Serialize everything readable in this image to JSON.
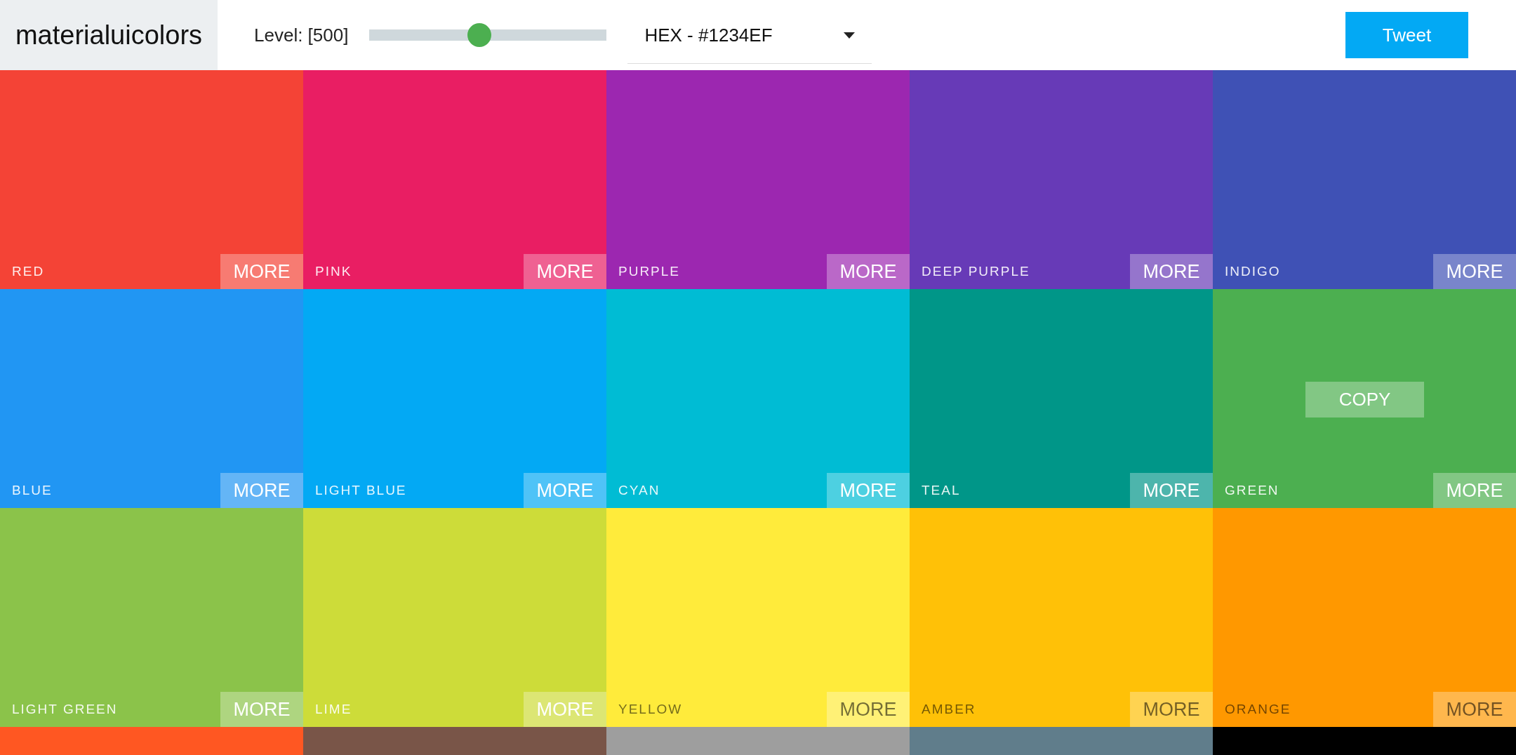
{
  "header": {
    "logo": "materialuicolors",
    "level_label": "Level: [500]",
    "slider": {
      "level": 0.46
    },
    "format_select": {
      "value": "HEX - #1234EF"
    },
    "tweet_button": "Tweet"
  },
  "tiles": [
    {
      "name": "RED",
      "color": "#f44336",
      "more": "MORE",
      "dark_text": false
    },
    {
      "name": "PINK",
      "color": "#e91e63",
      "more": "MORE",
      "dark_text": false
    },
    {
      "name": "PURPLE",
      "color": "#9c27b0",
      "more": "MORE",
      "dark_text": false
    },
    {
      "name": "DEEP PURPLE",
      "color": "#673ab7",
      "more": "MORE",
      "dark_text": false
    },
    {
      "name": "INDIGO",
      "color": "#3f51b5",
      "more": "MORE",
      "dark_text": false
    },
    {
      "name": "BLUE",
      "color": "#2196f3",
      "more": "MORE",
      "dark_text": false
    },
    {
      "name": "LIGHT BLUE",
      "color": "#03a9f4",
      "more": "MORE",
      "dark_text": false
    },
    {
      "name": "CYAN",
      "color": "#00bcd4",
      "more": "MORE",
      "dark_text": false
    },
    {
      "name": "TEAL",
      "color": "#009688",
      "more": "MORE",
      "dark_text": false
    },
    {
      "name": "GREEN",
      "color": "#4caf50",
      "more": "MORE",
      "copy": "COPY",
      "dark_text": false
    },
    {
      "name": "LIGHT GREEN",
      "color": "#8bc34a",
      "more": "MORE",
      "dark_text": false
    },
    {
      "name": "LIME",
      "color": "#cddc39",
      "more": "MORE",
      "dark_text": false
    },
    {
      "name": "YELLOW",
      "color": "#ffeb3b",
      "more": "MORE",
      "dark_text": true
    },
    {
      "name": "AMBER",
      "color": "#ffc107",
      "more": "MORE",
      "dark_text": true
    },
    {
      "name": "ORANGE",
      "color": "#ff9800",
      "more": "MORE",
      "dark_text": true
    },
    {
      "color": "#ff5722"
    },
    {
      "color": "#795548"
    },
    {
      "color": "#9e9e9e"
    },
    {
      "color": "#607d8b"
    },
    {
      "color": "#000000"
    }
  ]
}
